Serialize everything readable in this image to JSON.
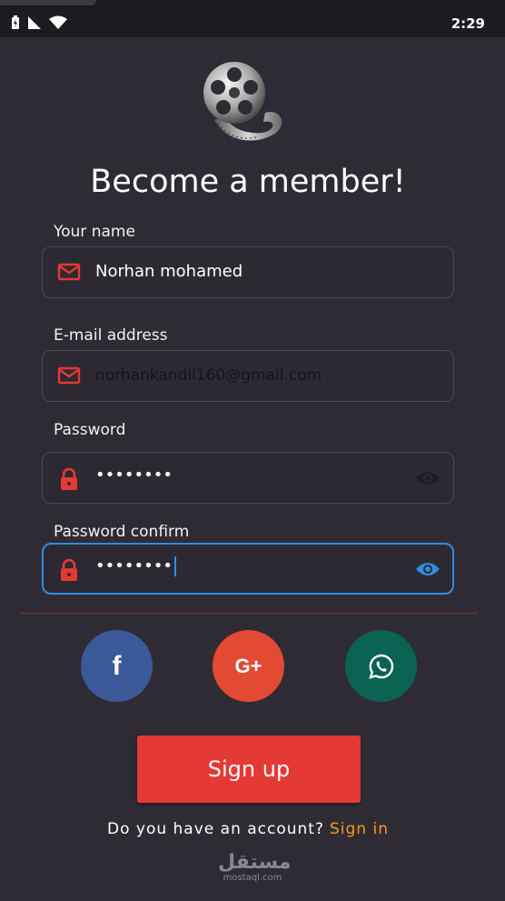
{
  "status_bar": {
    "time": "2:29",
    "icons": [
      "battery-charging-icon",
      "signal-icon",
      "wifi-icon",
      "notification-icon"
    ]
  },
  "header": {
    "title": "Become a member!"
  },
  "form": {
    "name": {
      "label": "Your name",
      "value": "Norhan mohamed",
      "icon": "mail-icon"
    },
    "email": {
      "label": "E-mail address",
      "value": "norhankandil160@gmail.com",
      "icon": "mail-icon"
    },
    "password": {
      "label": "Password",
      "value": "••••••••",
      "icon": "lock-icon",
      "visibility_icon": "eye-icon"
    },
    "password_confirm": {
      "label": "Password confirm",
      "value": "••••••••",
      "icon": "lock-icon",
      "visibility_icon": "eye-icon"
    }
  },
  "social": {
    "facebook": {
      "glyph": "f",
      "color": "#3b5998"
    },
    "google": {
      "glyph": "G+",
      "color": "#e24a32"
    },
    "whatsapp": {
      "color": "#0a6252"
    }
  },
  "actions": {
    "signup_label": "Sign up",
    "account_prompt": "Do you have an account?",
    "signin_label": "Sign in"
  },
  "watermark": {
    "arabic": "مستقل",
    "latin": "mostaql.com"
  },
  "colors": {
    "background": "#2f2b34",
    "primary_red": "#e53935",
    "focus_blue": "#2f8ee3",
    "link_orange": "#f59a23"
  }
}
